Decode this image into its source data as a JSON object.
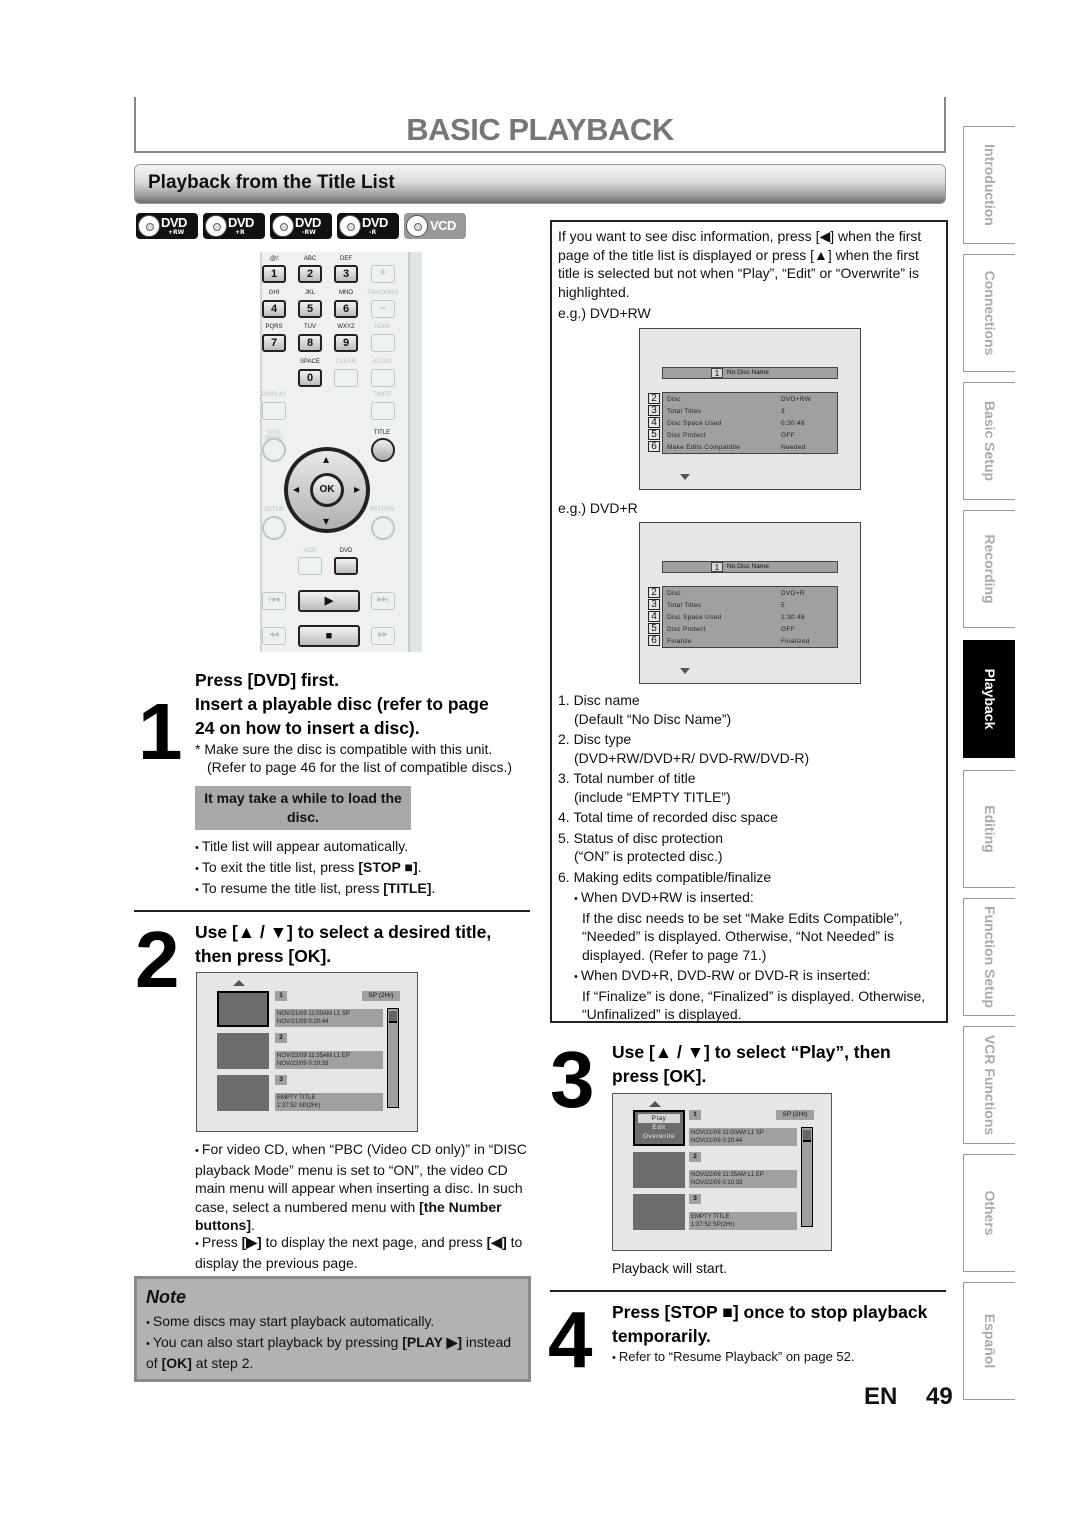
{
  "header": {
    "title": "BASIC PLAYBACK",
    "section_title": "Playback from the Title List"
  },
  "disc_icons": [
    {
      "label": "DVD",
      "sub": "+RW",
      "icon": "dvd-plus-rw-icon"
    },
    {
      "label": "DVD",
      "sub": "+R",
      "icon": "dvd-plus-r-icon"
    },
    {
      "label": "DVD",
      "sub": "-RW",
      "icon": "dvd-minus-rw-icon"
    },
    {
      "label": "DVD",
      "sub": "-R",
      "icon": "dvd-minus-r-icon"
    },
    {
      "label": "VCD",
      "sub": "",
      "icon": "vcd-icon"
    }
  ],
  "remote": {
    "keys": {
      "k1": "1",
      "k2": "2",
      "k3": "3",
      "k4": "4",
      "k5": "5",
      "k6": "6",
      "k7": "7",
      "k8": "8",
      "k9": "9",
      "k0": "0",
      "plus": "+",
      "minus": "–"
    },
    "labels": {
      "l1": ".@/:",
      "l2": "ABC",
      "l3": "DEF",
      "l4": "GHI",
      "l5": "JKL",
      "l6": "MNO",
      "l7": "PQRS",
      "l8": "TUV",
      "l9": "WXYZ",
      "l0": "SPACE",
      "tracking": "TRACKING",
      "hdmi": "HDMI",
      "clear": "CLEAR",
      "audio": "AUDIO",
      "display": "DISPLAY",
      "timer": "TIMER",
      "disc_menu": "DISC MENU",
      "title": "TITLE",
      "setup": "SETUP",
      "return": "RETURN",
      "vcr": "VCR",
      "dvd": "DVD"
    },
    "ok": "OK",
    "play": "▶",
    "stop": "■",
    "up": "▲",
    "down": "▼",
    "left": "◀",
    "right": "▶",
    "skip_back": "|◀◀",
    "skip_fwd": "▶▶|",
    "rew": "◀◀",
    "ff": "▶▶"
  },
  "step1": {
    "number": "1",
    "heading_line1": "Press [DVD] first.",
    "heading_line2": "Insert a playable disc (refer to page",
    "heading_line3": "24 on how to insert a disc).",
    "note_line1": "* Make sure the disc is compatible with this unit.",
    "note_line2": "(Refer to page 46 for the list of compatible discs.)",
    "load_box": "It may take a while to load the disc.",
    "bullets": [
      {
        "pre": "Title list will appear automatically.",
        "bold": "",
        "post": ""
      },
      {
        "pre": "To exit the title list, press ",
        "bold": "[STOP ■]",
        "post": "."
      },
      {
        "pre": "To resume the title list, press ",
        "bold": "[TITLE]",
        "post": "."
      }
    ]
  },
  "step2": {
    "number": "2",
    "heading_line1": "Use [▲ / ▼] to select a desired title,",
    "heading_line2": "then press [OK].",
    "bullet1_pre": "For video CD, when “PBC (Video CD only)” in “DISC playback Mode” menu is set to “ON”, the video CD main menu will appear when inserting a disc. In such case, select a numbered menu with ",
    "bullet1_bold": "[the Number buttons]",
    "bullet1_post": ".",
    "bullet2_pre": "Press ",
    "bullet2_bold1": "[▶]",
    "bullet2_mid": " to display the next page, and press ",
    "bullet2_bold2": "[◀]",
    "bullet2_post": " to display the previous page."
  },
  "title_list": {
    "mode": "SP (2Hr)",
    "items": [
      {
        "num": "1",
        "line1": "NOV/21/09  11:00AM L1  SP",
        "line2": "NOV/21/09    0:20:44"
      },
      {
        "num": "2",
        "line1": "NOV/22/09  11:35AM L1  EP",
        "line2": "NOV/22/09    0:10:33"
      },
      {
        "num": "3",
        "line1": "EMPTY TITLE",
        "line2": "1:37:52  SP(2Hr)"
      }
    ],
    "menu": [
      "Play",
      "Edit",
      "Overwrite"
    ]
  },
  "info_box": {
    "intro": "If you want to see disc information, press [◀] when the first page of the title list is displayed or press [▲] when the first title is selected but not when “Play”, “Edit” or “Overwrite” is highlighted.",
    "example1_label": "e.g.) DVD+RW",
    "example2_label": "e.g.) DVD+R",
    "screen1": {
      "name_idx": "1",
      "name": "No Disc Name",
      "rows": [
        {
          "idx": "2",
          "label": "Disc",
          "value": "DVD+RW"
        },
        {
          "idx": "3",
          "label": "Total Titles",
          "value": "3"
        },
        {
          "idx": "4",
          "label": "Disc Space Used",
          "value": "0:30:48"
        },
        {
          "idx": "5",
          "label": "Disc Protect",
          "value": "OFF"
        },
        {
          "idx": "6",
          "label": "Make Edits Compatible",
          "value": "Needed"
        }
      ]
    },
    "screen2": {
      "name_idx": "1",
      "name": "No Disc Name",
      "rows": [
        {
          "idx": "2",
          "label": "Disc",
          "value": "DVD+R"
        },
        {
          "idx": "3",
          "label": "Total Titles",
          "value": "5"
        },
        {
          "idx": "4",
          "label": "Disc Space Used",
          "value": "1:30:48"
        },
        {
          "idx": "5",
          "label": "Disc Protect",
          "value": "OFF"
        },
        {
          "idx": "6",
          "label": "Finalize",
          "value": "Finalized"
        }
      ]
    },
    "legend": [
      {
        "main": "1. Disc name",
        "sub": "(Default “No Disc Name”)"
      },
      {
        "main": "2. Disc type",
        "sub": "(DVD+RW/DVD+R/ DVD-RW/DVD-R)"
      },
      {
        "main": "3. Total number of title",
        "sub": "(include “EMPTY TITLE”)"
      },
      {
        "main": "4. Total time of recorded disc space",
        "sub": ""
      },
      {
        "main": "5. Status of disc protection",
        "sub": "(“ON” is protected disc.)"
      },
      {
        "main": "6. Making edits compatible/finalize",
        "sub": ""
      }
    ],
    "bullet1_head": "When DVD+RW is inserted:",
    "bullet1_body": "If the disc needs to be set “Make Edits Compatible”, “Needed” is displayed. Otherwise, “Not Needed” is displayed. (Refer to page 71.)",
    "bullet2_head": "When DVD+R, DVD-RW or DVD-R is inserted:",
    "bullet2_body": "If “Finalize” is done, “Finalized”  is displayed. Otherwise, “Unfinalized” is displayed."
  },
  "step3": {
    "number": "3",
    "heading_line1": "Use [▲ / ▼] to select “Play”, then",
    "heading_line2": "press [OK].",
    "result": "Playback will start."
  },
  "step4": {
    "number": "4",
    "heading_line1": "Press [STOP ■] once to stop playback",
    "heading_line2": "temporarily.",
    "bullet": "Refer to “Resume Playback” on page 52."
  },
  "note": {
    "title": "Note",
    "bullet1": "Some discs may start playback automatically.",
    "bullet2_pre": "You can also start playback by pressing ",
    "bullet2_bold1": "[PLAY ▶]",
    "bullet2_mid": " instead of ",
    "bullet2_bold2": "[OK]",
    "bullet2_post": " at step 2."
  },
  "side_tabs": [
    {
      "label": "Introduction",
      "active": false
    },
    {
      "label": "Connections",
      "active": false
    },
    {
      "label": "Basic Setup",
      "active": false
    },
    {
      "label": "Recording",
      "active": false
    },
    {
      "label": "Playback",
      "active": true
    },
    {
      "label": "Editing",
      "active": false
    },
    {
      "label": "Function Setup",
      "active": false
    },
    {
      "label": "VCR Functions",
      "active": false
    },
    {
      "label": "Others",
      "active": false
    },
    {
      "label": "Español",
      "active": false
    }
  ],
  "footer": {
    "lang": "EN",
    "page": "49"
  }
}
